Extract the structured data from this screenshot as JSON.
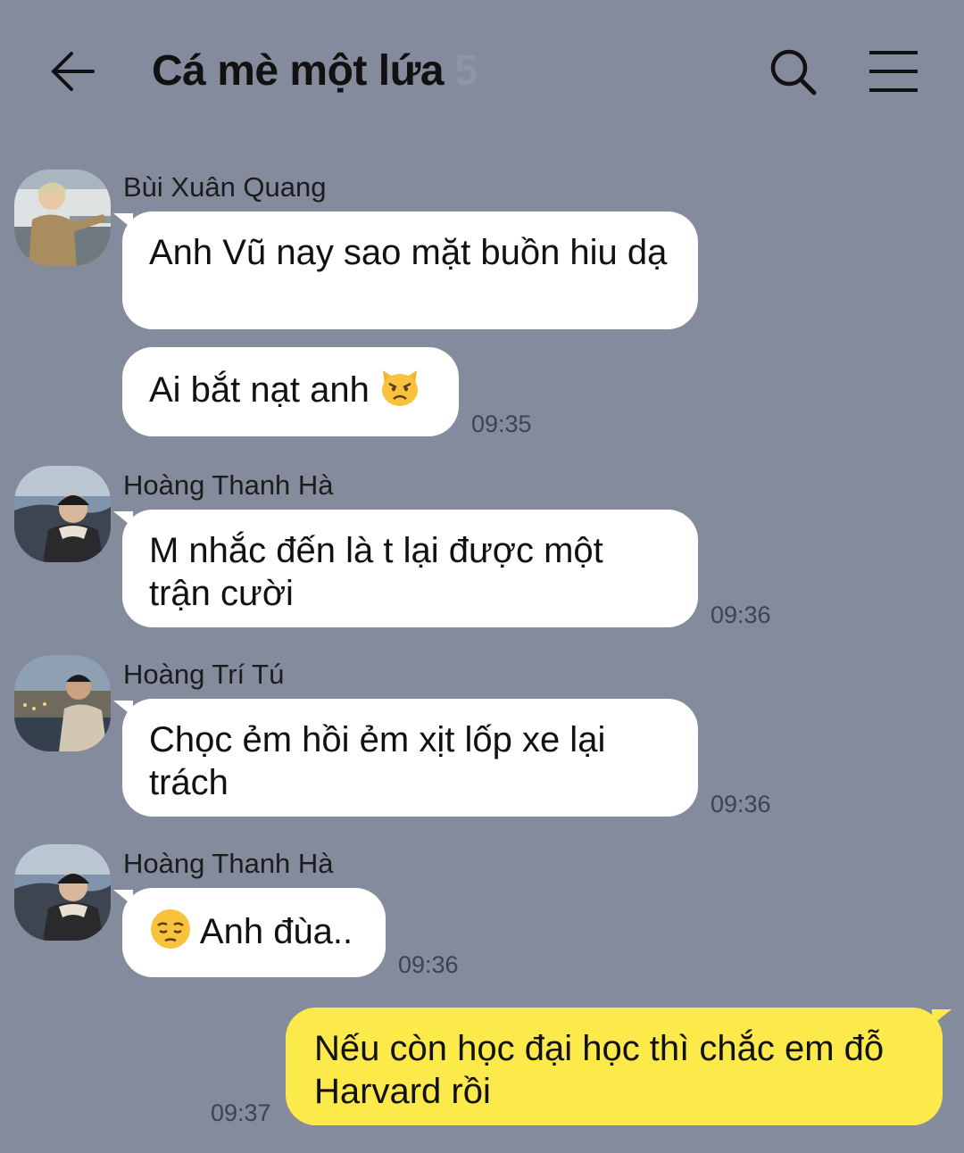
{
  "header": {
    "title": "Cá mè một lứa",
    "member_count": "5",
    "back_icon": "arrow-left-icon",
    "search_icon": "search-icon",
    "menu_icon": "hamburger-menu-icon"
  },
  "colors": {
    "background": "#838b9d",
    "incoming_bubble": "#ffffff",
    "outgoing_bubble": "#fce94a"
  },
  "messages": [
    {
      "sender": "Bùi Xuân Quang",
      "text": "Anh Vũ nay sao mặt buồn hiu dạ",
      "time": ""
    },
    {
      "sender": "Bùi Xuân Quang",
      "text": "Ai bắt nạt anh",
      "emoji": "pouting-cat-emoji",
      "time": "09:35"
    },
    {
      "sender": "Hoàng Thanh Hà",
      "text": "M nhắc đến là t lại được một trận cười",
      "time": "09:36"
    },
    {
      "sender": "Hoàng Trí Tú",
      "text": "Chọc ẻm hồi ẻm xịt lốp xe lại trách",
      "time": "09:36"
    },
    {
      "sender": "Hoàng Thanh Hà",
      "text": "Anh đùa..",
      "emoji": "pensive-face-emoji",
      "time": "09:36"
    },
    {
      "sender": "me",
      "text": "Nếu còn học đại học thì chắc em đỗ Harvard rồi",
      "time": "09:37"
    }
  ]
}
